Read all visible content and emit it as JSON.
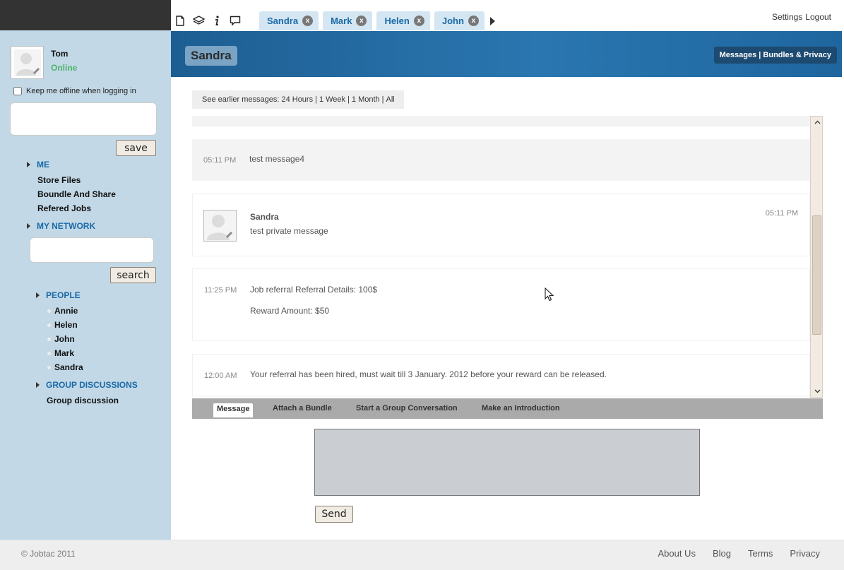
{
  "header": {
    "tabs": [
      {
        "label": "Sandra",
        "close": "x"
      },
      {
        "label": "Mark",
        "close": "x"
      },
      {
        "label": "Helen",
        "close": "x"
      },
      {
        "label": "John",
        "close": "x"
      }
    ],
    "settings": "Settings",
    "logout": "Logout",
    "icons": [
      "document-icon",
      "layers-icon",
      "info-icon",
      "chat-icon"
    ]
  },
  "sidebar": {
    "user_name": "Tom",
    "user_status": "Online",
    "offline_label": "Keep me offline when logging in",
    "save_label": "save",
    "me_label": "ME",
    "me_items": [
      "Store Files",
      "Boundle And Share",
      "Refered Jobs"
    ],
    "network_label": "MY NETWORK",
    "search_label": "search",
    "people_label": "PEOPLE",
    "people": [
      "Annie",
      "Helen",
      "John",
      "Mark",
      "Sandra"
    ],
    "groups_label": "GROUP DISCUSSIONS",
    "groups": [
      "Group discussion"
    ]
  },
  "banner": {
    "title": "Sandra",
    "links": "Messages | Bundles & Privacy"
  },
  "earlier": {
    "prefix": "See earlier messages:",
    "options": [
      "24 Hours",
      "1 Week",
      "1 Month",
      "All"
    ],
    "sep": "|"
  },
  "messages": [
    {
      "time": "05:11 PM",
      "text": "test message4"
    },
    {
      "sender": "Sandra",
      "time": "05:11 PM",
      "text": "test private message"
    },
    {
      "time": "11:25 PM",
      "text": "Job referral Referral Details: 100$",
      "text2": "Reward Amount: $50"
    },
    {
      "time": "12:00 AM",
      "text": "Your referral has been hired, must wait till 3 January. 2012 before your reward can be released."
    }
  ],
  "compose": {
    "tabs": [
      "Message",
      "Attach a Bundle",
      "Start a Group Conversation",
      "Make an Introduction"
    ],
    "send_label": "Send"
  },
  "footer": {
    "copyright": "© Jobtac 2011",
    "links": [
      "About Us",
      "Blog",
      "Terms",
      "Privacy"
    ]
  },
  "colors": {
    "sidebar_bg": "#c2d8e6",
    "link_blue": "#1a6aa8",
    "online_green": "#4db36b",
    "banner_blue": "#2a76b0"
  }
}
